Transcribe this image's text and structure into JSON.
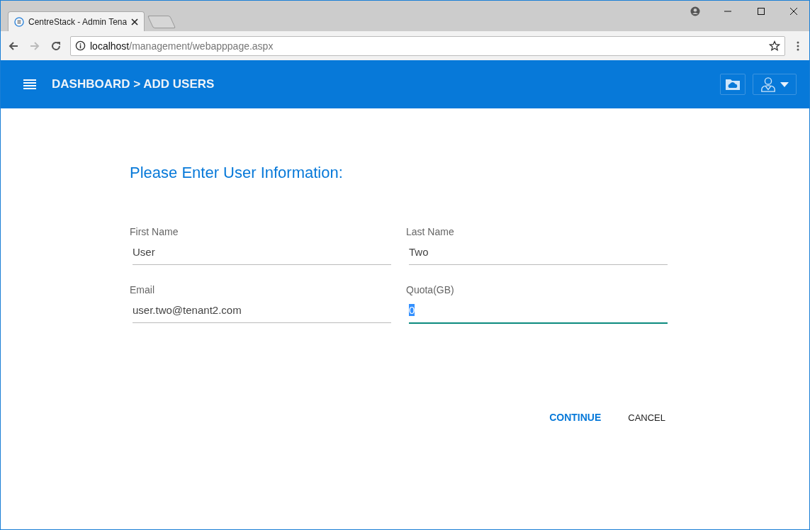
{
  "browser": {
    "tabs": [
      {
        "title": "CentreStack - Admin Tena",
        "selected": true
      }
    ],
    "address": {
      "host": "localhost",
      "path": "/management/webapppage.aspx"
    }
  },
  "header": {
    "breadcrumb": "DASHBOARD > ADD USERS"
  },
  "form": {
    "heading": "Please Enter User Information:",
    "fields": [
      {
        "label": "First Name",
        "value": "User",
        "focused": false
      },
      {
        "label": "Last Name",
        "value": "Two",
        "focused": false
      },
      {
        "label": "Email",
        "value": "user.two@tenant2.com",
        "focused": false
      },
      {
        "label": "Quota(GB)",
        "value": "0",
        "focused": true
      }
    ],
    "buttons": [
      {
        "label": "CONTINUE",
        "primary": true
      },
      {
        "label": "CANCEL",
        "primary": false
      }
    ]
  }
}
